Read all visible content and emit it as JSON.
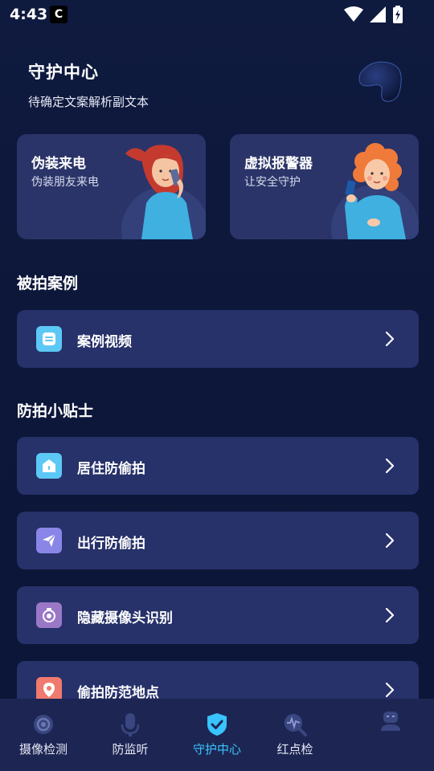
{
  "status_bar": {
    "time": "4:43",
    "app_icon_glyph": "C"
  },
  "header": {
    "title": "守护中心",
    "subtitle": "待确定文案解析副文本"
  },
  "feature_cards": [
    {
      "title": "伪装来电",
      "subtitle": "伪装朋友来电"
    },
    {
      "title": "虚拟报警器",
      "subtitle": "让安全守护"
    }
  ],
  "sections": {
    "cases_title": "被拍案例",
    "tips_title": "防拍小贴士"
  },
  "case_items": [
    {
      "label": "案例视频",
      "icon": "video-doc-icon",
      "color": "#5cc8f5"
    }
  ],
  "tip_items": [
    {
      "label": "居住防偷拍",
      "icon": "home-icon",
      "color": "#5cc8f5"
    },
    {
      "label": "出行防偷拍",
      "icon": "send-icon",
      "color": "#8a86e8"
    },
    {
      "label": "隐藏摄像头识别",
      "icon": "camera-icon",
      "color": "#9a78c8"
    },
    {
      "label": "偷拍防范地点",
      "icon": "location-icon",
      "color": "#f07a6e"
    }
  ],
  "bottom_nav": [
    {
      "label": "摄像检测",
      "icon": "camera-lens-icon",
      "active": false
    },
    {
      "label": "防监听",
      "icon": "microphone-icon",
      "active": false
    },
    {
      "label": "守护中心",
      "icon": "shield-check-icon",
      "active": true
    },
    {
      "label": "红点检",
      "icon": "search-pulse-icon",
      "active": false
    },
    {
      "label": "",
      "icon": "person-icon",
      "active": false
    }
  ],
  "colors": {
    "background": "#0d173a",
    "card": "#27316a",
    "feature_card": "#2a3468",
    "nav_bg": "#1d2653",
    "accent": "#39c4ff"
  }
}
